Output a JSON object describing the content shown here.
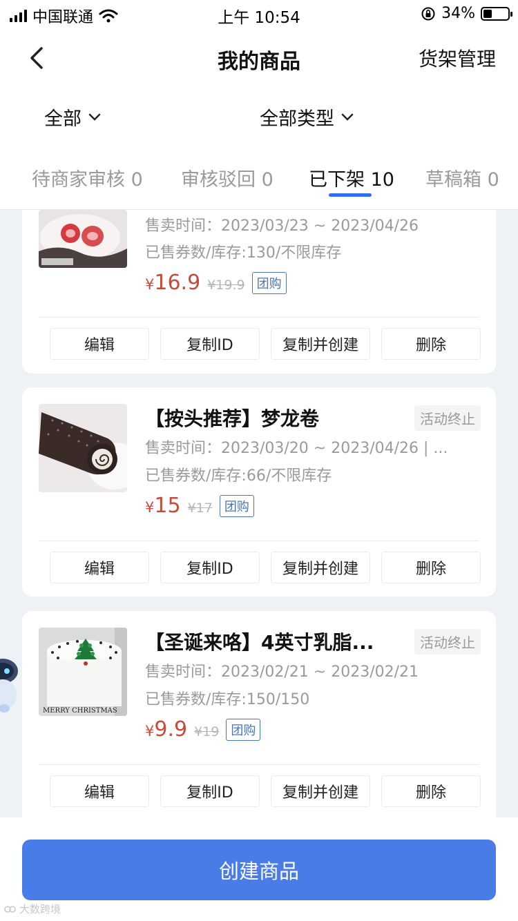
{
  "status_bar": {
    "carrier": "中国联通",
    "time": "上午 10:54",
    "battery": "34%",
    "battery_level": 0.34
  },
  "nav": {
    "title": "我的商品",
    "right_action": "货架管理"
  },
  "filters": {
    "all": "全部",
    "all_types": "全部类型"
  },
  "tabs": [
    {
      "label": "待商家审核",
      "count": "0"
    },
    {
      "label": "审核驳回",
      "count": "0"
    },
    {
      "label": "已下架",
      "count": "10",
      "active": true
    },
    {
      "label": "草稿箱",
      "count": "0"
    }
  ],
  "actions": {
    "edit": "编辑",
    "copy_id": "复制ID",
    "copy_create": "复制并创建",
    "delete": "删除"
  },
  "products": [
    {
      "title": "",
      "status": "",
      "sale_time": "售卖时间：2023/03/23 ~ 2023/04/26",
      "stock": "已售券数/库存:130/不限库存",
      "price_symbol": "¥",
      "price": "16.9",
      "original_price": "¥19.9",
      "tag": "团购",
      "image_icon": "strawberry-dessert-image"
    },
    {
      "title": "【按头推荐】梦龙卷",
      "status": "活动终止",
      "sale_time": "售卖时间：2023/03/20 ~ 2023/04/26 | ...",
      "stock": "已售券数/库存:66/不限库存",
      "price_symbol": "¥",
      "price": "15",
      "original_price": "¥17",
      "tag": "团购",
      "image_icon": "chocolate-roll-cake-image"
    },
    {
      "title": "【圣诞来咯】4英寸乳脂...",
      "status": "活动终止",
      "sale_time": "售卖时间：2023/02/21 ~ 2023/02/21",
      "stock": "已售券数/库存:150/150",
      "price_symbol": "¥",
      "price": "9.9",
      "original_price": "¥19",
      "tag": "团购",
      "image_icon": "christmas-cake-image",
      "image_text": "MERRY CHRISTMAS"
    }
  ],
  "create_button": "创建商品",
  "watermark": "大数跨境",
  "colors": {
    "accent": "#2f6df0",
    "button": "#4a7ce8",
    "price": "#c84a3a",
    "tag": "#4a74b8"
  }
}
